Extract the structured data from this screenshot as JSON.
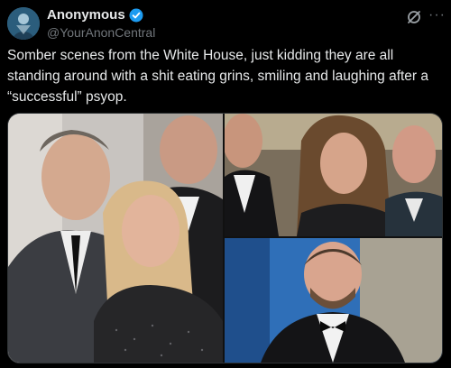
{
  "author": {
    "display_name": "Anonymous",
    "handle": "@YourAnonCentral"
  },
  "post": {
    "text": "Somber scenes from the White House, just kidding they are all standing around with a shit eating grins, smiling and laughing  after a “successful” psyop."
  },
  "icons": {
    "verified": "verified-badge-icon",
    "grok": "grok-icon",
    "more": "more-options-icon"
  },
  "colors": {
    "background": "#000000",
    "text": "#e7e9ea",
    "secondary_text": "#71767b",
    "verified_blue": "#1d9bf0"
  }
}
